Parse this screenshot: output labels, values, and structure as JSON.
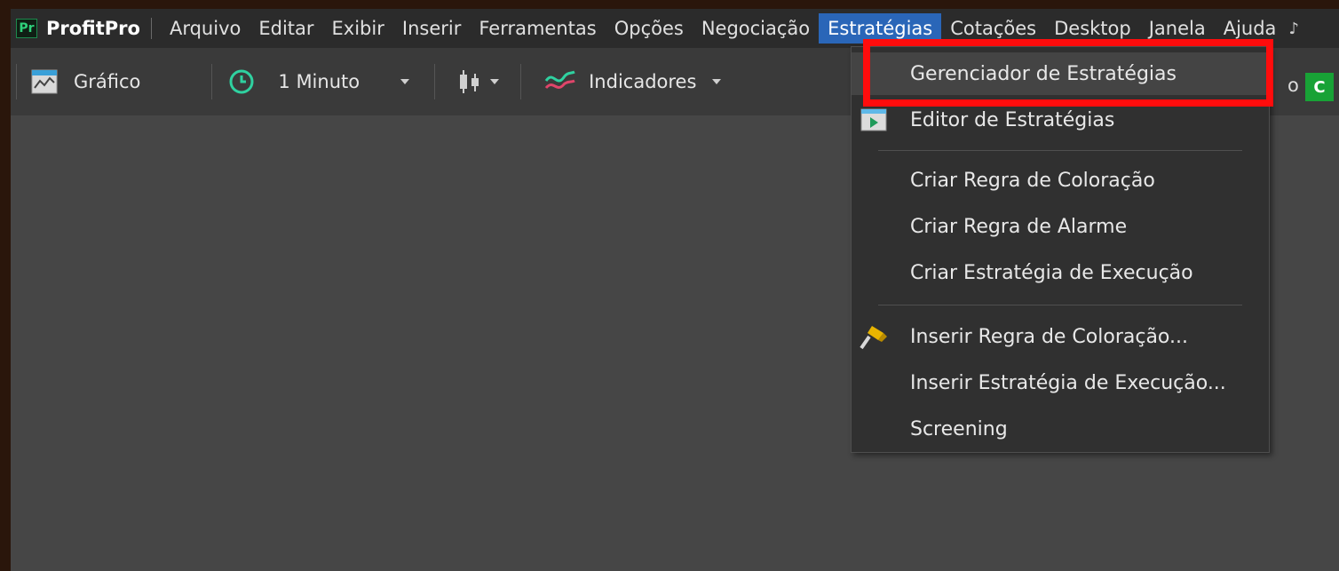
{
  "menubar": {
    "app_badge": "Pr",
    "app_name": "ProfitPro",
    "items": [
      "Arquivo",
      "Editar",
      "Exibir",
      "Inserir",
      "Ferramentas",
      "Opções",
      "Negociação",
      "Estratégias",
      "Cotações",
      "Desktop",
      "Janela",
      "Ajuda"
    ],
    "active_item": "Estratégias",
    "overflow": "♪"
  },
  "toolbar": {
    "chart_label": "Gráfico",
    "interval_label": "1 Minuto",
    "indicators_label": "Indicadores",
    "right_partial_text": "o",
    "right_button_label": "C"
  },
  "dropdown": {
    "items": [
      "Gerenciador de Estratégias",
      "Editor de Estratégias",
      "Criar Regra de Coloração",
      "Criar Regra de Alarme",
      "Criar Estratégia de Execução",
      "Inserir Regra de Coloração...",
      "Inserir Estratégia de Execução...",
      "Screening"
    ],
    "highlighted_item": "Gerenciador de Estratégias"
  },
  "colors": {
    "menu_active": "#2a66b8",
    "highlight_box": "#ff0c0c",
    "accent_green": "#18a236",
    "chart_area": "#464646"
  },
  "icons": {
    "chart": "line-chart-icon",
    "clock": "clock-icon",
    "candles": "candlestick-icon",
    "indicators": "indicators-icon",
    "editor": "editor-play-icon",
    "coloring": "paint-brush-icon"
  }
}
